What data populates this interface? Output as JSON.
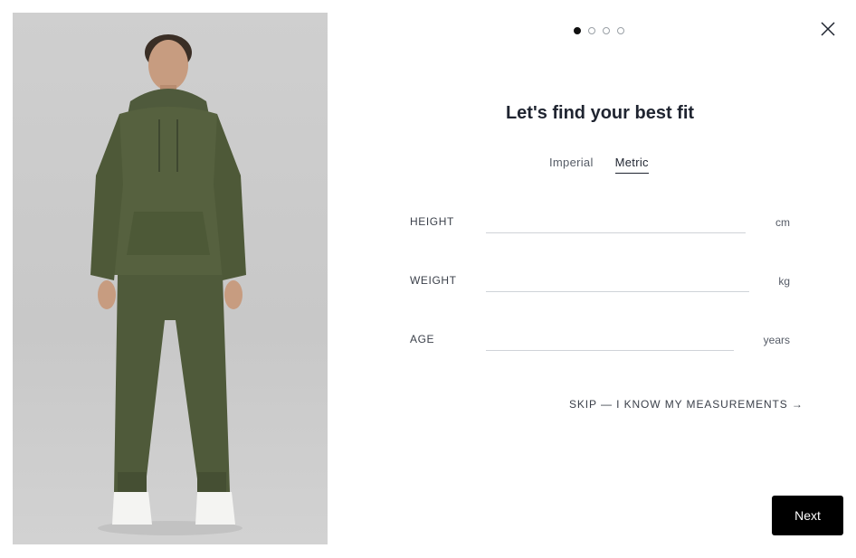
{
  "product_image": {
    "alt_icon": "model-photo"
  },
  "steps": {
    "total": 4,
    "current": 1
  },
  "close_icon": "close-icon",
  "title": "Let's find your best fit",
  "unit_tabs": [
    {
      "label": "Imperial",
      "active": false
    },
    {
      "label": "Metric",
      "active": true
    }
  ],
  "fields": {
    "height": {
      "label": "HEIGHT",
      "value": "",
      "unit": "cm"
    },
    "weight": {
      "label": "WEIGHT",
      "value": "",
      "unit": "kg"
    },
    "age": {
      "label": "AGE",
      "value": "",
      "unit": "years"
    }
  },
  "skip_link": "SKIP — I KNOW MY MEASUREMENTS →",
  "next_button": "Next"
}
